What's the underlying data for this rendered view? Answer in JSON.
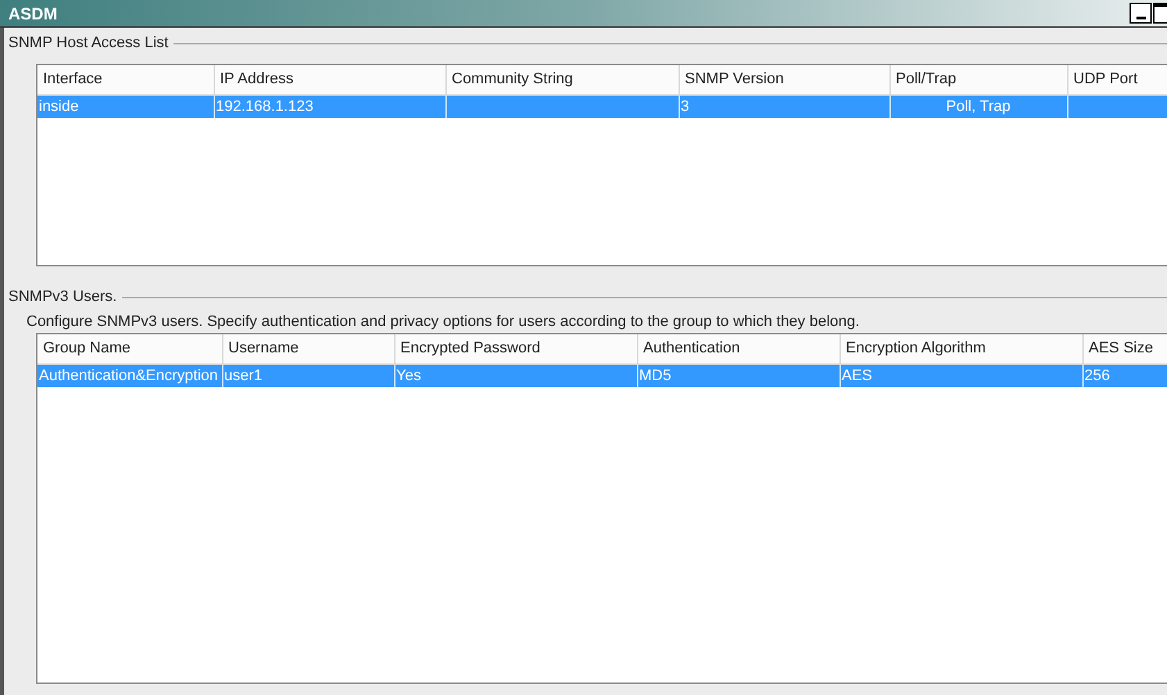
{
  "window": {
    "title": "ASDM"
  },
  "host_access": {
    "title": "SNMP Host Access List",
    "columns": [
      "Interface",
      "IP Address",
      "Community String",
      "SNMP Version",
      "Poll/Trap",
      "UDP Port"
    ],
    "rows": [
      {
        "selected": true,
        "cells": [
          "inside",
          "192.168.1.123",
          "",
          "3",
          "Poll, Trap",
          ""
        ]
      }
    ]
  },
  "users": {
    "title": "SNMPv3 Users.",
    "description": "Configure SNMPv3 users. Specify authentication and privacy options for users according to the group to which they belong.",
    "columns": [
      "Group Name",
      "Username",
      "Encrypted Password",
      "Authentication",
      "Encryption Algorithm",
      "AES Size"
    ],
    "rows": [
      {
        "selected": true,
        "cells": [
          "Authentication&Encryption",
          "user1",
          "Yes",
          "MD5",
          "AES",
          "256"
        ]
      }
    ]
  }
}
